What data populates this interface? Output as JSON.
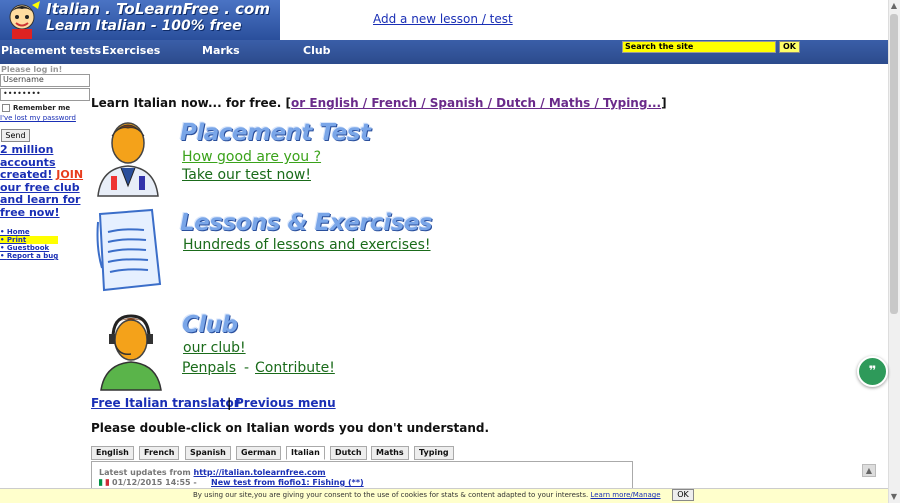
{
  "header": {
    "logo_line_1": "Italian . ToLearnFree . com",
    "logo_line_2": "Learn Italian - 100% free",
    "add_lesson": "Add a new lesson / test"
  },
  "nav": {
    "items": [
      "Placement tests",
      "Exercises",
      "Marks",
      "Club"
    ],
    "search_placeholder": "Search the site",
    "search_ok": "OK"
  },
  "sidebar": {
    "login_title": "Please log in!",
    "username_placeholder": "Username",
    "password_value": "••••••••",
    "remember_label": "Remember me",
    "lost_password": "I've lost my password",
    "send_label": "Send",
    "promo_1": "2 million accounts created!",
    "promo_join": "JOIN",
    "promo_2": " our free club and learn for free now!",
    "links": [
      "Home",
      "Print",
      "Guestbook",
      "Report a bug"
    ]
  },
  "main": {
    "intro_text": "Learn Italian now... for free. [",
    "intro_link": "or English / French / Spanish / Dutch / Maths / Typing...",
    "intro_end": "]",
    "placement_title": "Placement Test",
    "placement_link_1": "How good are you ?",
    "placement_link_2": "Take our test now!",
    "lessons_title": "Lessons & Exercises",
    "lessons_link": "Hundreds of lessons and exercises!",
    "club_title": "Club",
    "club_link_1": "our club!",
    "club_link_2": "Penpals",
    "club_dash": "-",
    "club_link_3": "Contribute!",
    "translator_link": "Free Italian translator",
    "separator": "|",
    "previous_menu": "Previous menu",
    "dblclick_text": "Please double-click on Italian words you don't understand.",
    "lang_tabs": [
      "English",
      "French",
      "Spanish",
      "German",
      "Italian",
      "Dutch",
      "Maths",
      "Typing"
    ],
    "updates_title": "Latest updates from ",
    "updates_url": "http://italian.tolearnfree.com",
    "update_date": "01/12/2015 14:55 - ",
    "update_link": "New test from fiofio1: Fishing (**)"
  },
  "cookie": {
    "text": "By using our site,you are giving your consent to the use of cookies for stats & content adapted to your interests.",
    "link": "Learn more/Manage",
    "ok": "OK"
  },
  "widgets": {
    "chat_icon": "quote-icon",
    "scroll_top_icon": "chevron-up-icon"
  },
  "colors": {
    "nav_bg": "#2c4b8c",
    "search_bg": "#ffff00",
    "section_title": "#7aa6e8",
    "section_link": "#3aa21a",
    "chat_btn": "#2e9a5a"
  }
}
